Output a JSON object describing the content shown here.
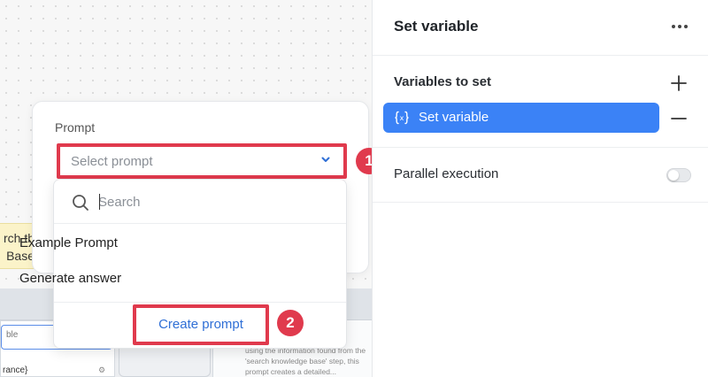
{
  "canvas": {
    "yellow_node_text": "rch th Base",
    "yellow_node_line1": "rch th",
    "yellow_node_line2": "Base",
    "left_card_row1": "ble",
    "left_card_row2": "rance}",
    "right_card_desc": "using the information found from the 'search knowledge base' step, this prompt creates a detailed..."
  },
  "prompt_panel": {
    "label": "Prompt",
    "select_placeholder": "Select prompt",
    "search_placeholder": "Search",
    "options": [
      "Example Prompt",
      "Generate answer"
    ],
    "create_label": "Create prompt",
    "badges": [
      "1",
      "2"
    ]
  },
  "side_panel": {
    "title": "Set variable",
    "variables_heading": "Variables to set",
    "variable_item": "Set variable",
    "parallel_label": "Parallel execution",
    "parallel_enabled": false
  },
  "colors": {
    "accent": "#3b82f6",
    "highlight": "#e03a4d",
    "link": "#2f6fd6"
  },
  "icons": [
    "chevron-down-icon",
    "search-icon",
    "more-icon",
    "plus-icon",
    "minus-icon",
    "variable-icon",
    "gear-icon"
  ]
}
